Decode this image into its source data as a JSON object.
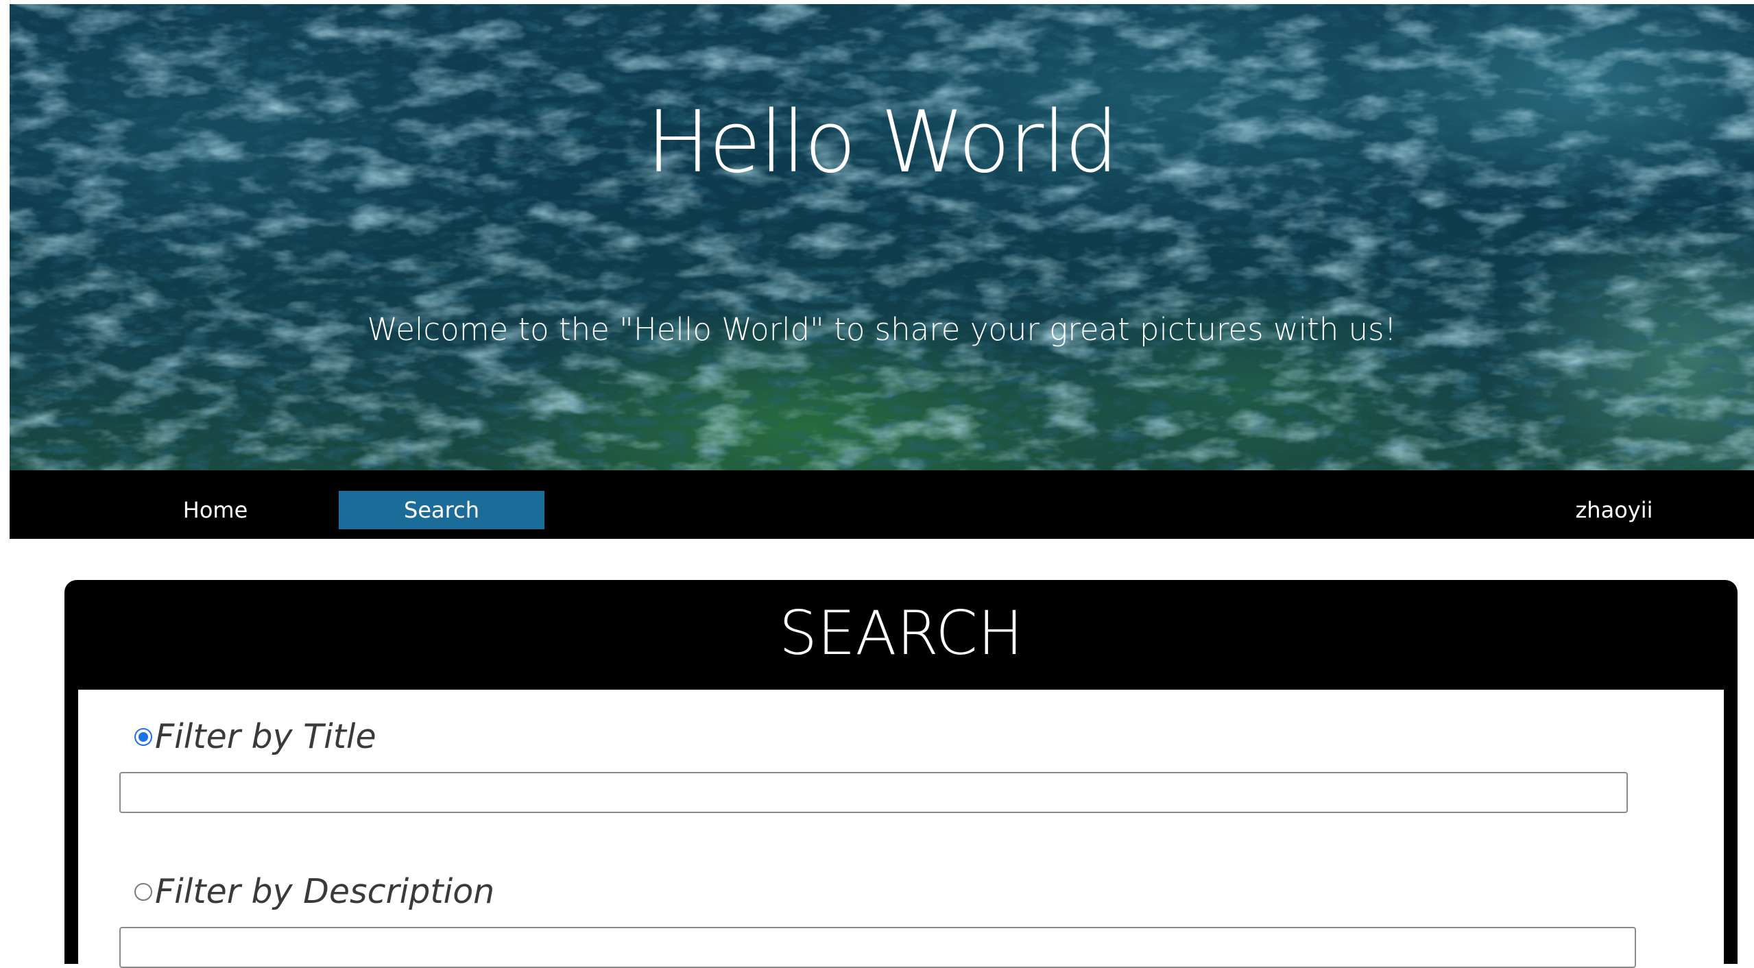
{
  "hero": {
    "title": "Hello World",
    "subtitle": "Welcome to the \"Hello World\" to share your great pictures with us!"
  },
  "nav": {
    "items": [
      {
        "label": "Home",
        "active": false
      },
      {
        "label": "Search",
        "active": true
      }
    ],
    "user": "zhaoyii",
    "active_color": "#1c6c9a"
  },
  "search_panel": {
    "title": "SEARCH",
    "filters": [
      {
        "label": "Filter by Title",
        "selected": true,
        "value": ""
      },
      {
        "label": "Filter by Description",
        "selected": false,
        "value": ""
      }
    ]
  }
}
